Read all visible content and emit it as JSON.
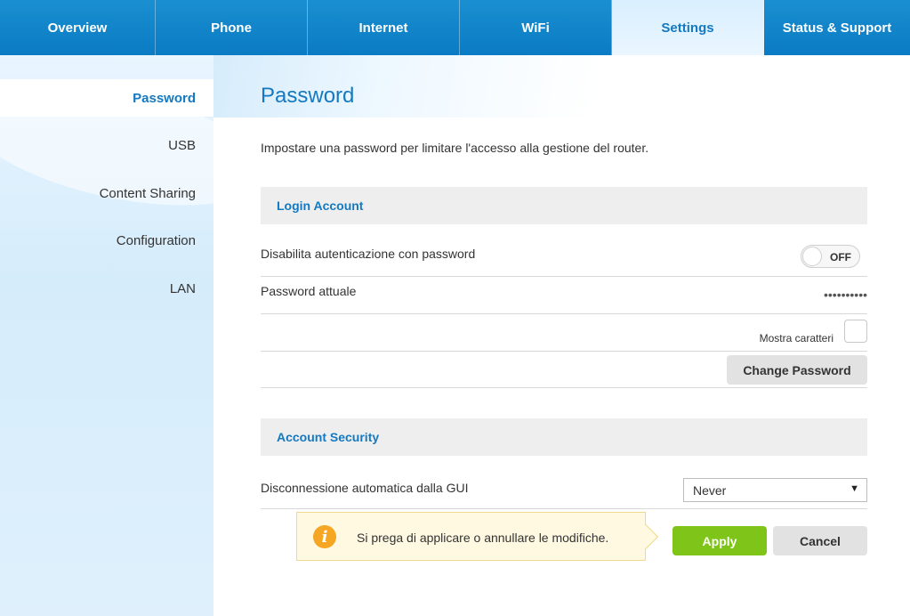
{
  "nav": {
    "tabs": [
      {
        "label": "Overview"
      },
      {
        "label": "Phone"
      },
      {
        "label": "Internet"
      },
      {
        "label": "WiFi"
      },
      {
        "label": "Settings"
      },
      {
        "label": "Status & Support"
      }
    ],
    "active": "Settings"
  },
  "sidebar": {
    "items": [
      {
        "label": "Password"
      },
      {
        "label": "USB"
      },
      {
        "label": "Content Sharing"
      },
      {
        "label": "Configuration"
      },
      {
        "label": "LAN"
      }
    ],
    "active": "Password"
  },
  "page": {
    "title": "Password",
    "intro": "Impostare una password per limitare l'accesso alla gestione del router."
  },
  "login_account": {
    "heading": "Login Account",
    "disable_auth_label": "Disabilita autenticazione con password",
    "toggle_state": "OFF",
    "current_password_label": "Password attuale",
    "current_password_value": "••••••••••",
    "show_chars_label": "Mostra caratteri",
    "change_password_button": "Change Password"
  },
  "account_security": {
    "heading": "Account Security",
    "auto_disconnect_label": "Disconnessione automatica dalla GUI",
    "auto_disconnect_value": "Never"
  },
  "notice": {
    "message": "Si prega di applicare o annullare le modifiche."
  },
  "actions": {
    "apply": "Apply",
    "cancel": "Cancel"
  },
  "colors": {
    "brand_blue": "#1479c0",
    "apply_green": "#7fc418",
    "info_orange": "#f5a623"
  },
  "icons": {
    "info": "info-icon",
    "dropdown": "triangle-down-icon"
  }
}
